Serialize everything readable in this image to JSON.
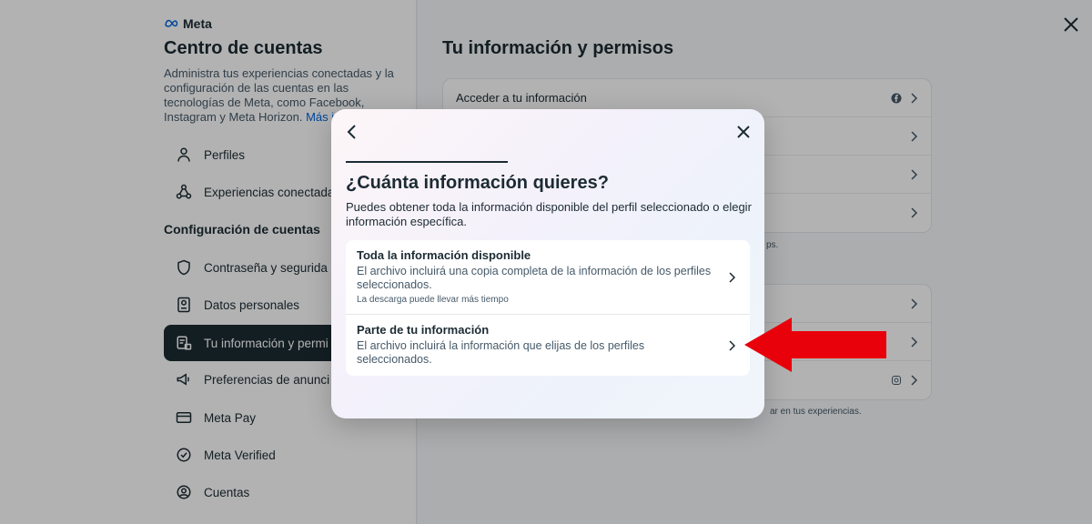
{
  "brand": {
    "name": "Meta"
  },
  "sidebar": {
    "title": "Centro de cuentas",
    "description": "Administra tus experiencias conectadas y la configuración de las cuentas en las tecnologías de Meta, como Facebook, Instagram y Meta Horizon.",
    "more_link": "Más in",
    "items": [
      {
        "label": "Perfiles",
        "icon": "person-icon"
      },
      {
        "label": "Experiencias conectada",
        "icon": "connected-icon"
      }
    ],
    "section_title": "Configuración de cuentas",
    "settings_items": [
      {
        "label": "Contraseña y segurida",
        "icon": "shield-icon"
      },
      {
        "label": "Datos personales",
        "icon": "id-card-icon"
      },
      {
        "label": "Tu información y permi",
        "icon": "info-lock-icon",
        "active": true
      },
      {
        "label": "Preferencias de anunci",
        "icon": "megaphone-icon"
      },
      {
        "label": "Meta Pay",
        "icon": "card-icon"
      },
      {
        "label": "Meta Verified",
        "icon": "verified-badge-icon"
      },
      {
        "label": "Cuentas",
        "icon": "account-circle-icon"
      }
    ]
  },
  "main": {
    "title": "Tu información y permisos",
    "group1": [
      {
        "label": "Acceder a tu información",
        "icon": "facebook-icon"
      },
      {
        "label": ""
      },
      {
        "label": ""
      },
      {
        "label": ""
      }
    ],
    "note1": "ps.",
    "group2": [
      {
        "label": ""
      },
      {
        "label": ""
      },
      {
        "label": "",
        "icon": "instagram-icon"
      }
    ],
    "note2": "ar en tus experiencias."
  },
  "modal": {
    "title": "¿Cuánta información quieres?",
    "description": "Puedes obtener toda la información disponible del perfil seleccionado o elegir información específica.",
    "options": [
      {
        "title": "Toda la información disponible",
        "description": "El archivo incluirá una copia completa de la información de los perfiles seleccionados.",
        "note": "La descarga puede llevar más tiempo"
      },
      {
        "title": "Parte de tu información",
        "description": "El archivo incluirá la información que elijas de los perfiles seleccionados."
      }
    ]
  },
  "colors": {
    "accent": "#0064e0",
    "dark": "#1c2b33",
    "arrow": "#e8000b"
  }
}
